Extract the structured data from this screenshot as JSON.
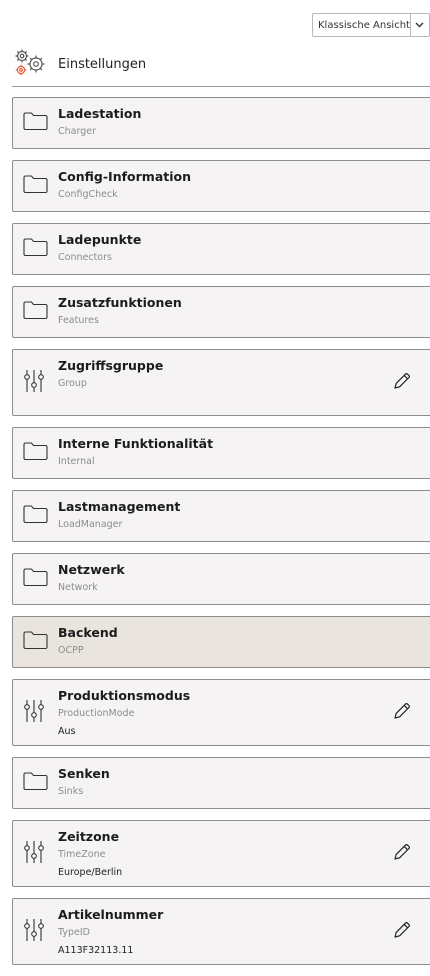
{
  "header": {
    "view_toggle_label": "Klassische Ansicht",
    "title": "Einstellungen"
  },
  "items": [
    {
      "title": "Ladestation",
      "subtitle": "Charger",
      "icon": "folder-icon"
    },
    {
      "title": "Config-Information",
      "subtitle": "ConfigCheck",
      "icon": "folder-icon"
    },
    {
      "title": "Ladepunkte",
      "subtitle": "Connectors",
      "icon": "folder-icon"
    },
    {
      "title": "Zusatzfunktionen",
      "subtitle": "Features",
      "icon": "folder-icon"
    },
    {
      "title": "Zugriffsgruppe",
      "subtitle": "Group",
      "icon": "sliders-icon",
      "editable": true
    },
    {
      "title": "Interne Funktionalität",
      "subtitle": "Internal",
      "icon": "folder-icon"
    },
    {
      "title": "Lastmanagement",
      "subtitle": "LoadManager",
      "icon": "folder-icon"
    },
    {
      "title": "Netzwerk",
      "subtitle": "Network",
      "icon": "folder-icon"
    },
    {
      "title": "Backend",
      "subtitle": "OCPP",
      "icon": "folder-icon",
      "active": true
    },
    {
      "title": "Produktionsmodus",
      "subtitle": "ProductionMode",
      "value": "Aus",
      "icon": "sliders-icon",
      "editable": true
    },
    {
      "title": "Senken",
      "subtitle": "Sinks",
      "icon": "folder-icon"
    },
    {
      "title": "Zeitzone",
      "subtitle": "TimeZone",
      "value": "Europe/Berlin",
      "icon": "sliders-icon",
      "editable": true
    },
    {
      "title": "Artikelnummer",
      "subtitle": "TypeID",
      "value": "A113F32113.11",
      "icon": "sliders-icon",
      "editable": true
    }
  ],
  "colors": {
    "card_bg": "#f6f3f4",
    "card_active_bg": "#eae4df",
    "gear_accent": "#e0603a"
  }
}
